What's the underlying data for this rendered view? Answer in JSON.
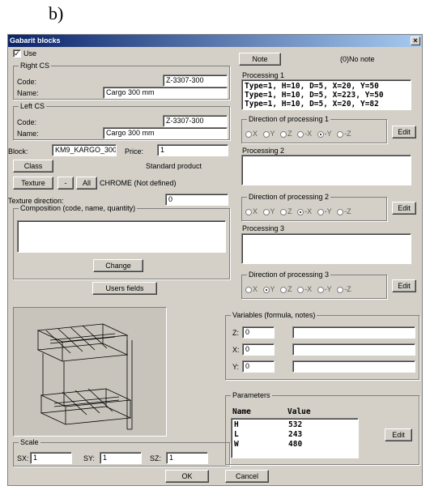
{
  "caption": "b)",
  "window": {
    "title": "Gabarit blocks",
    "close": "×"
  },
  "use": {
    "label": "Use",
    "checked": "✓"
  },
  "right_cs": {
    "legend": "Right CS",
    "code_label": "Code:",
    "code": "Z-3307-300",
    "name_label": "Name:",
    "name": "Cargo 300 mm"
  },
  "left_cs": {
    "legend": "Left CS",
    "code_label": "Code:",
    "code": "Z-3307-300",
    "name_label": "Name:",
    "name": "Cargo 300 mm"
  },
  "block": {
    "label": "Block:",
    "value": "KM9_KARGO_300",
    "price_label": "Price:",
    "price": "1"
  },
  "class_button": "Class",
  "product_type": "Standard product",
  "texture": {
    "button": "Texture",
    "minus": "-",
    "all": "All",
    "value": "CHROME (Not defined)"
  },
  "texture_direction": {
    "label": "Texture direction:",
    "value": "0"
  },
  "composition": {
    "legend": "Composition (code, name, quantity)"
  },
  "change_button": "Change",
  "users_fields_button": "Users fields",
  "scale": {
    "legend": "Scale",
    "sx_label": "SX:",
    "sx": "1",
    "sy_label": "SY:",
    "sy": "1",
    "sz_label": "SZ:",
    "sz": "1"
  },
  "ok_button": "OK",
  "cancel_button": "Cancel",
  "note": {
    "button": "Note",
    "value": "(0)No note"
  },
  "processing1": {
    "label": "Processing 1",
    "lines": [
      "Type=1, H=10, D=5, X=20, Y=50",
      "Type=1, H=10, D=5, X=223, Y=50",
      "Type=1, H=10, D=5, X=20, Y=82"
    ]
  },
  "direction1": {
    "legend": "Direction of processing 1",
    "options": [
      "X",
      "Y",
      "Z",
      "-X",
      "-Y",
      "-Z"
    ],
    "selected": "-Y",
    "edit": "Edit"
  },
  "processing2": {
    "label": "Processing 2"
  },
  "direction2": {
    "legend": "Direction of processing 2",
    "options": [
      "X",
      "Y",
      "Z",
      "-X",
      "-Y",
      "-Z"
    ],
    "selected": "-X",
    "edit": "Edit"
  },
  "processing3": {
    "label": "Processing 3"
  },
  "direction3": {
    "legend": "Direction of processing 3",
    "options": [
      "X",
      "Y",
      "Z",
      "-X",
      "-Y",
      "-Z"
    ],
    "selected": "Y",
    "edit": "Edit"
  },
  "variables": {
    "legend": "Variables (formula, notes)",
    "rows": [
      {
        "label": "Z:",
        "value": "0"
      },
      {
        "label": "X:",
        "value": "0"
      },
      {
        "label": "Y:",
        "value": "0"
      }
    ]
  },
  "parameters": {
    "legend": "Parameters",
    "col_name": "Name",
    "col_value": "Value",
    "rows": [
      {
        "name": "H",
        "value": "532"
      },
      {
        "name": "L",
        "value": "243"
      },
      {
        "name": "W",
        "value": "480"
      }
    ],
    "edit": "Edit"
  }
}
